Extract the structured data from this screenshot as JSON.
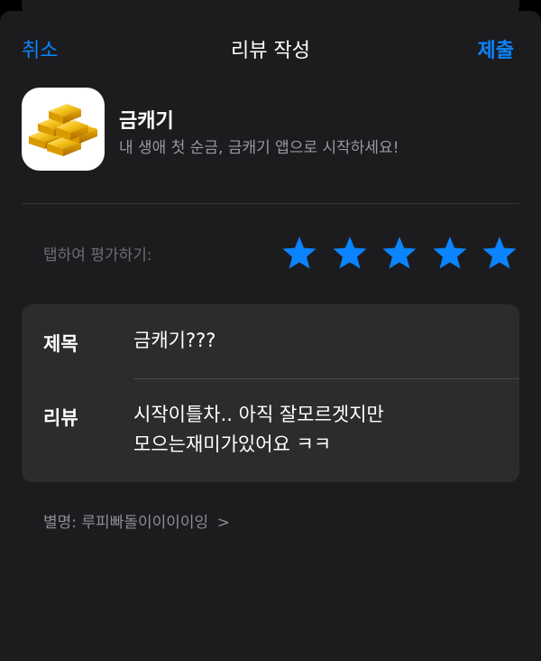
{
  "nav": {
    "cancel": "취소",
    "title": "리뷰 작성",
    "submit": "제출"
  },
  "app": {
    "name": "금캐기",
    "tagline": "내 생애 첫 순금, 금캐기 앱으로 시작하세요!",
    "icon": "gold-bars-icon"
  },
  "rating": {
    "label": "탭하여 평가하기:",
    "stars": 5,
    "max": 5,
    "star_color": "#0a84ff"
  },
  "form": {
    "title_label": "제목",
    "title_value": "금캐기???",
    "review_label": "리뷰",
    "review_value": "시작이틀차.. 아직 잘모르겟지만\n모으는재미가있어요 ㅋㅋ"
  },
  "nickname": {
    "text": "별명: 루피빠돌이이이이잉",
    "chevron": ">"
  },
  "colors": {
    "accent": "#0a84ff",
    "background": "#1c1c1e",
    "card": "#2c2c2e"
  }
}
